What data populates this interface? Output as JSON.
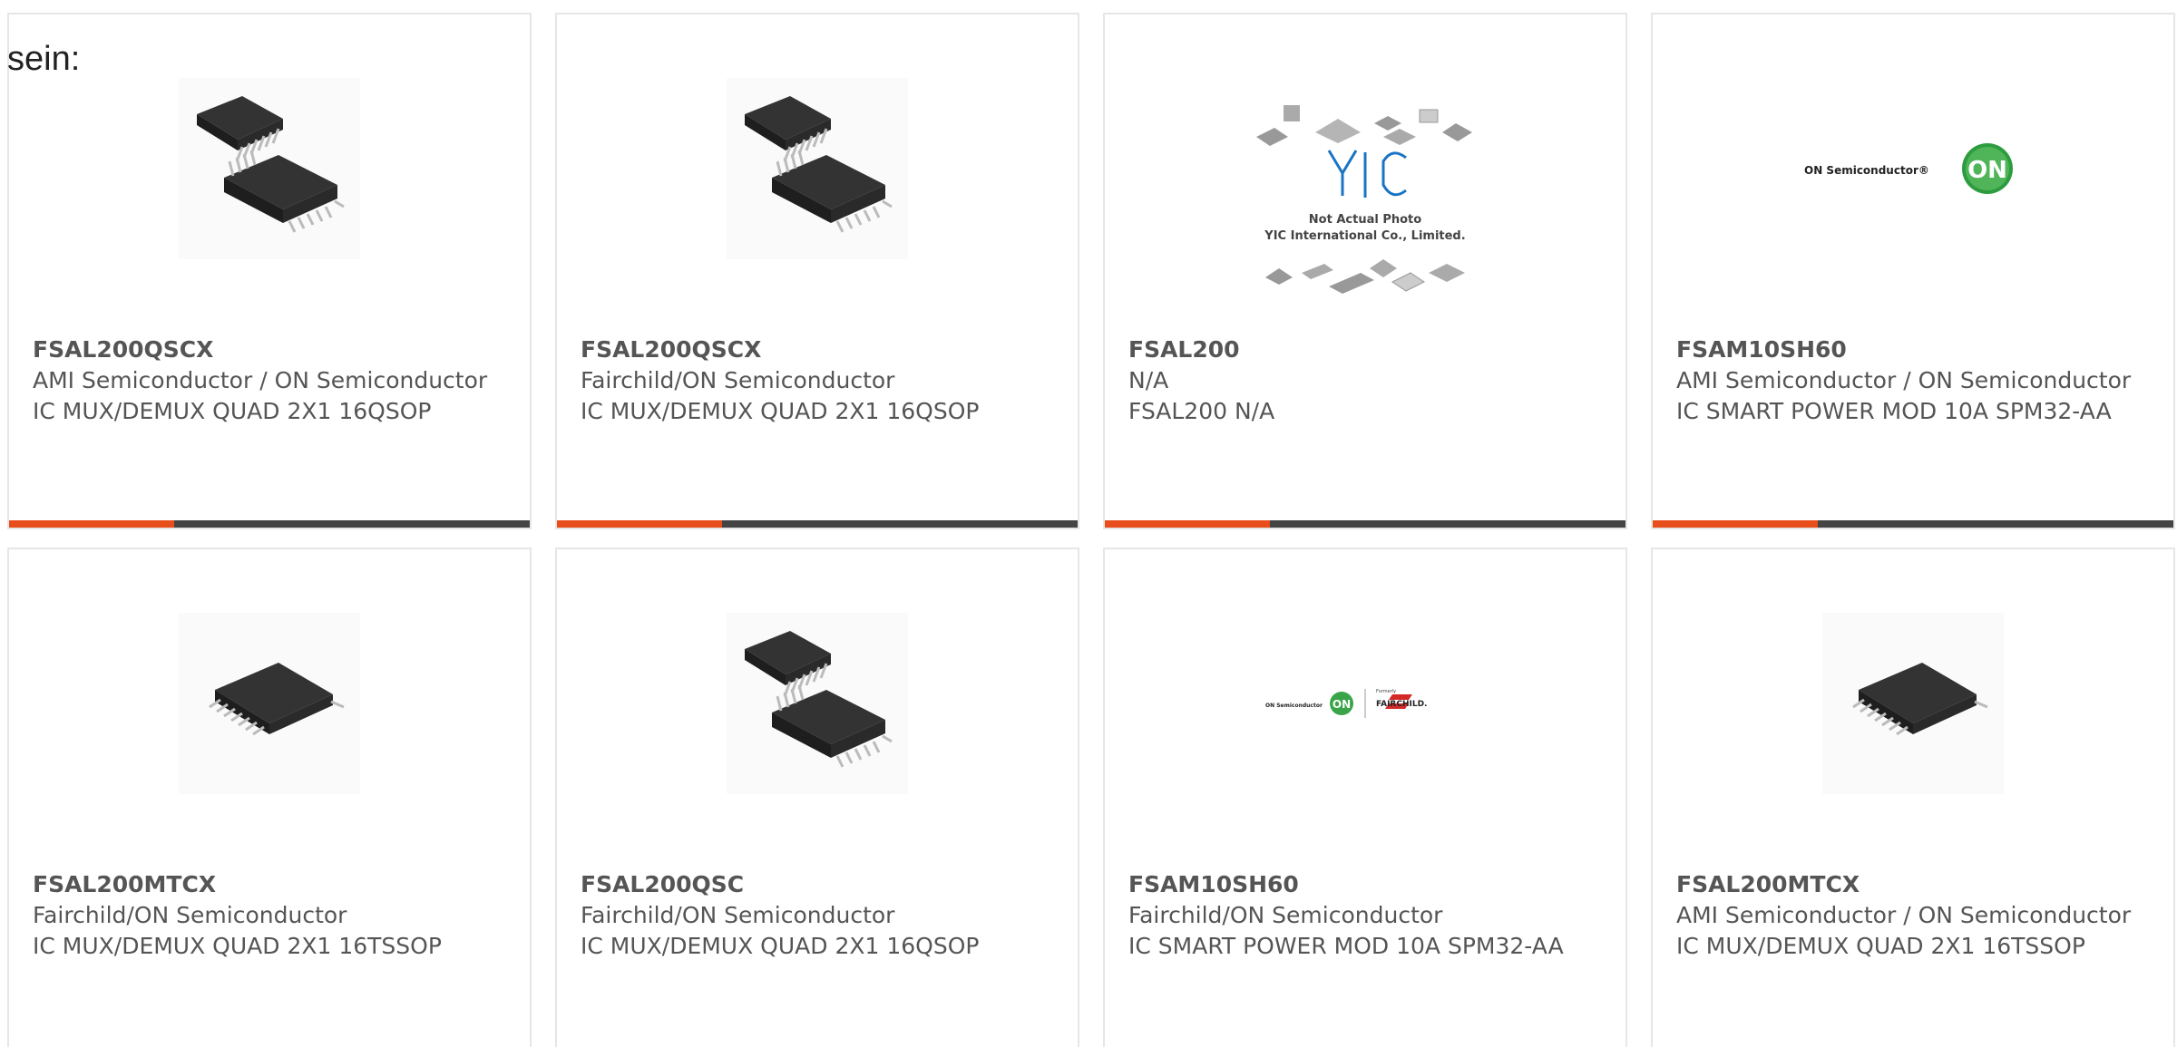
{
  "lead_text": "sein:",
  "colors": {
    "accent": "#e84e1b",
    "bar": "#444444",
    "border": "#e6e6e6",
    "text": "#555555"
  },
  "cards": [
    {
      "part_number": "FSAL200QSCX",
      "manufacturer": "AMI Semiconductor / ON Semiconductor",
      "description": "IC MUX/DEMUX QUAD 2X1 16QSOP",
      "image": "qsop-chip-image"
    },
    {
      "part_number": "FSAL200QSCX",
      "manufacturer": "Fairchild/ON Semiconductor",
      "description": "IC MUX/DEMUX QUAD 2X1 16QSOP",
      "image": "qsop-chip-image"
    },
    {
      "part_number": "FSAL200",
      "manufacturer": "N/A",
      "description": "FSAL200 N/A",
      "image": "yic-placeholder-image",
      "image_text": [
        "YIC",
        "Not Actual Photo",
        "YIC International Co., Limited."
      ]
    },
    {
      "part_number": "FSAM10SH60",
      "manufacturer": "AMI Semiconductor / ON Semiconductor",
      "description": "IC SMART POWER MOD 10A SPM32-AA",
      "image": "on-semiconductor-logo",
      "image_text": [
        "ON Semiconductor®",
        "ON"
      ]
    },
    {
      "part_number": "FSAL200MTCX",
      "manufacturer": "Fairchild/ON Semiconductor",
      "description": "IC MUX/DEMUX QUAD 2X1 16TSSOP",
      "image": "tssop-chip-image"
    },
    {
      "part_number": "FSAL200QSC",
      "manufacturer": "Fairchild/ON Semiconductor",
      "description": "IC MUX/DEMUX QUAD 2X1 16QSOP",
      "image": "qsop-chip-image"
    },
    {
      "part_number": "FSAM10SH60",
      "manufacturer": "Fairchild/ON Semiconductor",
      "description": "IC SMART POWER MOD 10A SPM32-AA",
      "image": "on-fairchild-logo",
      "image_text": [
        "ON Semiconductor",
        "ON",
        "Formerly",
        "FAIRCHILD."
      ]
    },
    {
      "part_number": "FSAL200MTCX",
      "manufacturer": "AMI Semiconductor / ON Semiconductor",
      "description": "IC MUX/DEMUX QUAD 2X1 16TSSOP",
      "image": "tssop-chip-image"
    }
  ]
}
